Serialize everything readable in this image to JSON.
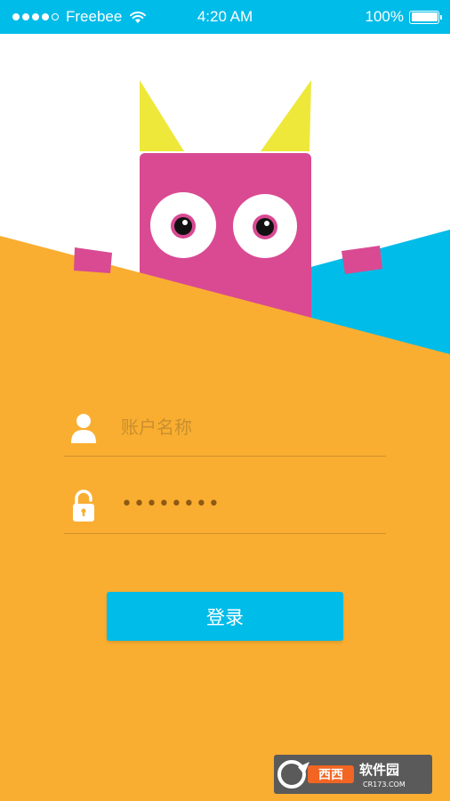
{
  "status_bar": {
    "carrier": "Freebee",
    "time": "4:20 AM",
    "battery": "100%",
    "battery_level": 1.0,
    "signal_bars_filled": 4,
    "signal_bars_total": 5
  },
  "login_form": {
    "username_placeholder": "账户名称",
    "password_display": "••••••••",
    "login_label": "登录"
  },
  "colors": {
    "accent_blue": "#00BCE8",
    "background_orange": "#F9AE31",
    "monster_pink": "#D94A93",
    "horn_yellow": "#EEE83A"
  },
  "icons": {
    "username": "user-icon",
    "password": "lock-icon"
  }
}
